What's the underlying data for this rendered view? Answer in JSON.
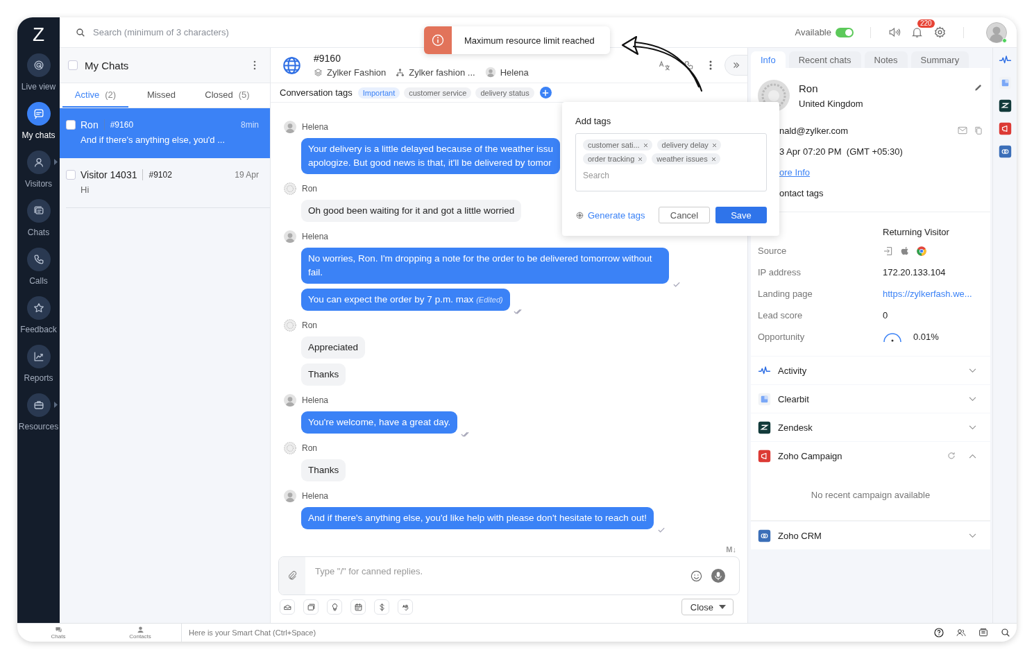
{
  "app": {
    "logo": "Z"
  },
  "nav": [
    {
      "label": "Live view",
      "selected": false,
      "has_submenu": false
    },
    {
      "label": "My chats",
      "selected": true,
      "has_submenu": false
    },
    {
      "label": "Visitors",
      "selected": false,
      "has_submenu": true
    },
    {
      "label": "Chats",
      "selected": false,
      "has_submenu": false
    },
    {
      "label": "Calls",
      "selected": false,
      "has_submenu": false
    },
    {
      "label": "Feedback",
      "selected": false,
      "has_submenu": false
    },
    {
      "label": "Reports",
      "selected": false,
      "has_submenu": false
    },
    {
      "label": "Resources",
      "selected": false,
      "has_submenu": true
    }
  ],
  "topbar": {
    "search_placeholder": "Search (minimum of 3 characters)",
    "status_label": "Available",
    "status_on": true,
    "notification_count": "220",
    "online": true
  },
  "toast": {
    "message": "Maximum resource limit reached"
  },
  "chat_list": {
    "title": "My Chats",
    "checked": false,
    "tabs": [
      {
        "label": "Active",
        "count": "(2)",
        "selected": true
      },
      {
        "label": "Missed",
        "selected": false
      },
      {
        "label": "Closed",
        "count": "(5)",
        "selected": false
      }
    ],
    "items": [
      {
        "name": "Ron",
        "id": "#9160",
        "time": "8min",
        "preview": "And if there's anything else, you'd ...",
        "selected": true,
        "checked": false
      },
      {
        "name": "Visitor 14031",
        "id": "#9102",
        "time": "19 Apr",
        "preview": "Hi",
        "selected": false,
        "checked": false
      }
    ]
  },
  "conversation": {
    "id": "#9160",
    "brand": "Zylker Fashion",
    "department": "Zylker fashion ...",
    "agent": "Helena",
    "tags_label": "Conversation tags",
    "tags": [
      {
        "label": "Important",
        "highlighted": true
      },
      {
        "label": "customer service",
        "highlighted": false
      },
      {
        "label": "delivery status",
        "highlighted": false
      }
    ],
    "groups": [
      {
        "sender": "Helena",
        "kind": "agent",
        "messages": [
          {
            "text": "Your delivery is a little delayed because of the weather issu\napologize. But good news is that, it'll be delivered by tomor"
          }
        ]
      },
      {
        "sender": "Ron",
        "kind": "visitor",
        "messages": [
          {
            "text": "Oh good been waiting for it and got a little worried"
          }
        ]
      },
      {
        "sender": "Helena",
        "kind": "agent",
        "messages": [
          {
            "text": "No worries, Ron. I'm dropping a note for the order to be delivered tomorrow without fail.",
            "delivered": false
          },
          {
            "text": "You can expect the order by 7 p.m. max",
            "edited_label": "(Edited)",
            "delivered": true
          }
        ]
      },
      {
        "sender": "Ron",
        "kind": "visitor",
        "messages": [
          {
            "text": "Appreciated"
          },
          {
            "text": "Thanks"
          }
        ]
      },
      {
        "sender": "Helena",
        "kind": "agent",
        "messages": [
          {
            "text": "You're welcome, have a great day.",
            "delivered": true
          }
        ]
      },
      {
        "sender": "Ron",
        "kind": "visitor",
        "messages": [
          {
            "text": "Thanks"
          }
        ]
      },
      {
        "sender": "Helena",
        "kind": "agent",
        "messages": [
          {
            "text": "And if there's anything else, you'd like help with please don't hesitate to reach out!",
            "delivered": false
          }
        ]
      }
    ],
    "markdown_toggle": "M↓",
    "composer_placeholder": "Type \"/\" for canned replies.",
    "close_button": "Close"
  },
  "add_tags": {
    "title": "Add tags",
    "chips": [
      "customer sati...",
      "delivery delay",
      "order tracking",
      "weather issues"
    ],
    "search_placeholder": "Search",
    "generate": "Generate tags",
    "cancel": "Cancel",
    "save": "Save"
  },
  "info_panel": {
    "tabs": [
      {
        "label": "Info",
        "selected": true
      },
      {
        "label": "Recent chats",
        "selected": false
      },
      {
        "label": "Notes",
        "selected": false
      },
      {
        "label": "Summary",
        "selected": false
      }
    ],
    "visitor": {
      "name": "Ron",
      "country": "United Kingdom",
      "email": "nald@zylker.com",
      "local_time": "3 Apr 07:20 PM  (GMT +05:30)",
      "more_info": "ore Info",
      "contact_tags": "ontact tags"
    },
    "visitor_type": "Returning Visitor",
    "details": [
      {
        "label": "Source",
        "kind": "icons"
      },
      {
        "label": "IP address",
        "kind": "text",
        "value": "172.20.133.104"
      },
      {
        "label": "Landing page",
        "kind": "link",
        "value": "https://zylkerfash.we..."
      },
      {
        "label": "Lead score",
        "kind": "text",
        "value": "0"
      },
      {
        "label": "Opportunity",
        "kind": "gauge",
        "value": "0.01%"
      }
    ],
    "sections": [
      {
        "title": "Activity",
        "expanded": false
      },
      {
        "title": "Clearbit",
        "expanded": false
      },
      {
        "title": "Zendesk",
        "expanded": false
      },
      {
        "title": "Zoho Campaign",
        "expanded": true,
        "empty_text": "No recent campaign available"
      },
      {
        "title": "Zoho CRM",
        "expanded": false
      }
    ]
  },
  "bottom_bar": {
    "tabs": [
      "Chats",
      "Contacts"
    ],
    "smart_chat_placeholder": "Here is your Smart Chat (Ctrl+Space)"
  }
}
